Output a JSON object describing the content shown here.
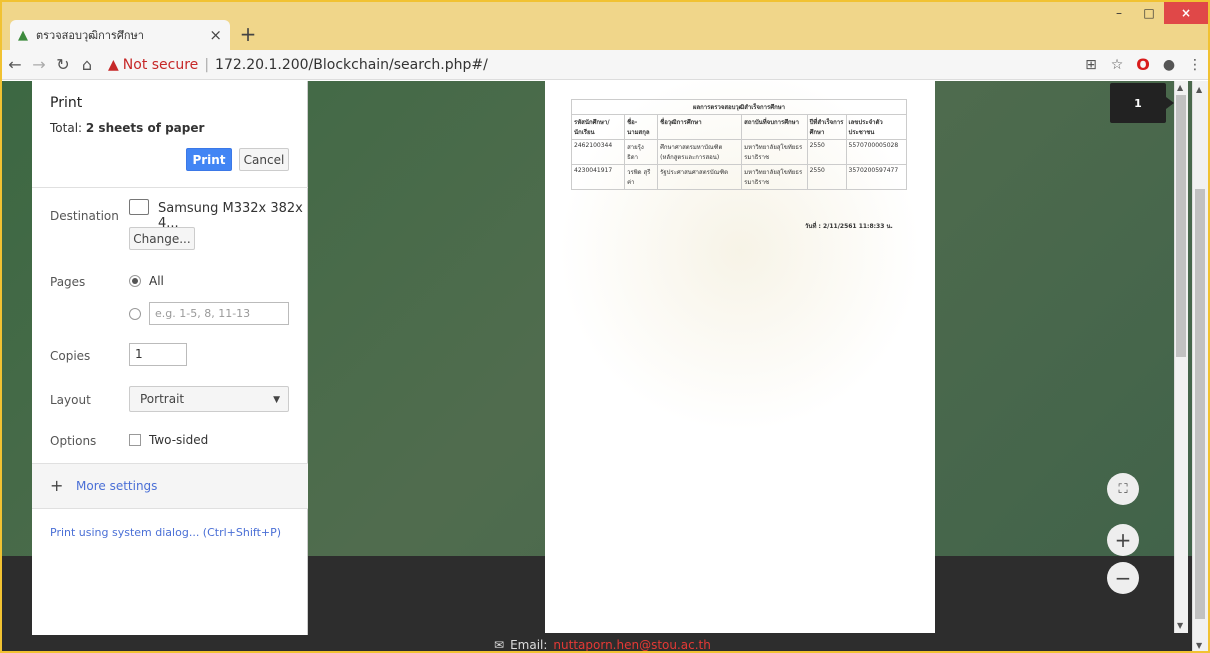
{
  "tab": {
    "title": "ตรวจสอบวุฒิการศึกษา",
    "close": "×",
    "new": "+"
  },
  "window_controls": {
    "minimize": "–",
    "maximize": "□",
    "close": "×"
  },
  "toolbar": {
    "not_secure": "Not secure",
    "separator": "|",
    "url": "172.20.1.200/Blockchain/search.php#/"
  },
  "print": {
    "title": "Print",
    "total_label": "Total:",
    "total_value": "2 sheets of paper",
    "print_button": "Print",
    "cancel_button": "Cancel",
    "destination_label": "Destination",
    "destination_value": "Samsung M332x 382x 4...",
    "change_button": "Change...",
    "pages_label": "Pages",
    "pages_all": "All",
    "pages_placeholder": "e.g. 1-5, 8, 11-13",
    "copies_label": "Copies",
    "copies_value": "1",
    "layout_label": "Layout",
    "layout_value": "Portrait",
    "options_label": "Options",
    "two_sided": "Two-sided",
    "more_settings": "More settings",
    "system_dialog": "Print using system dialog... (Ctrl+Shift+P)"
  },
  "preview": {
    "table_title": "ผลการตรวจสอบวุฒิสำเร็จการศึกษา",
    "headers": [
      "รหัสนักศึกษา/นักเรียน",
      "ชื่อ-นามสกุล",
      "ชื่อวุฒิการศึกษา",
      "สถาบันที่จบการศึกษา",
      "ปีที่สำเร็จการศึกษา",
      "เลขประจำตัวประชาชน"
    ],
    "rows": [
      [
        "2462100344",
        "สายรุ้ง ธิดา",
        "ศึกษาศาสตรมหาบัณฑิต (หลักสูตรและการสอน)",
        "มหาวิทยาลัยสุโขทัยธรรมาธิราช",
        "2550",
        "5570700005028"
      ],
      [
        "4230041917",
        "วรพิด สุรีค่า",
        "รัฐประศาสนศาสตรบัณฑิต",
        "มหาวิทยาลัยสุโขทัยธรรมาธิราช",
        "2550",
        "3570200597477"
      ]
    ],
    "date": "วันที่ : 2/11/2561 11:8:33 น.",
    "page_number": "1"
  },
  "footer": {
    "email_label": "Email:",
    "email": "nuttaporn.hen@stou.ac.th"
  }
}
